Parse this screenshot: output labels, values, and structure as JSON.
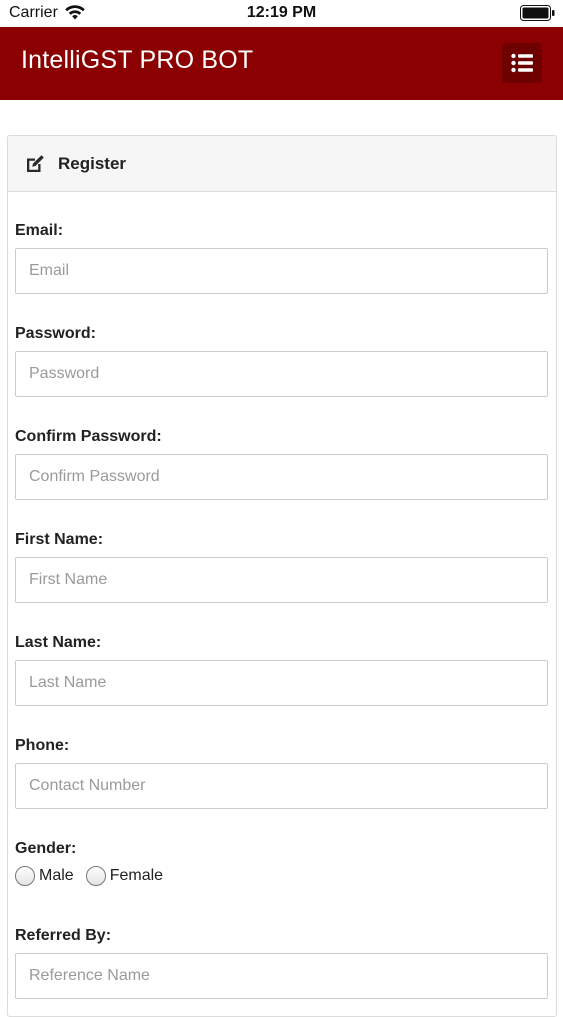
{
  "status_bar": {
    "carrier": "Carrier",
    "time": "12:19 PM"
  },
  "app": {
    "title": "IntelliGST PRO BOT",
    "header_color": "#8b0000",
    "menu_icon": "list-menu-icon"
  },
  "form": {
    "title": "Register",
    "title_icon": "edit-icon",
    "fields": {
      "email": {
        "label": "Email:",
        "placeholder": "Email"
      },
      "password": {
        "label": "Password:",
        "placeholder": "Password"
      },
      "confirm_password": {
        "label": "Confirm Password:",
        "placeholder": "Confirm Password"
      },
      "first_name": {
        "label": "First Name:",
        "placeholder": "First Name"
      },
      "last_name": {
        "label": "Last Name:",
        "placeholder": "Last Name"
      },
      "phone": {
        "label": "Phone:",
        "placeholder": "Contact Number"
      },
      "referred_by": {
        "label": "Referred By:",
        "placeholder": "Reference Name"
      }
    },
    "gender": {
      "label": "Gender:",
      "options": [
        "Male",
        "Female"
      ],
      "selected": null
    }
  }
}
